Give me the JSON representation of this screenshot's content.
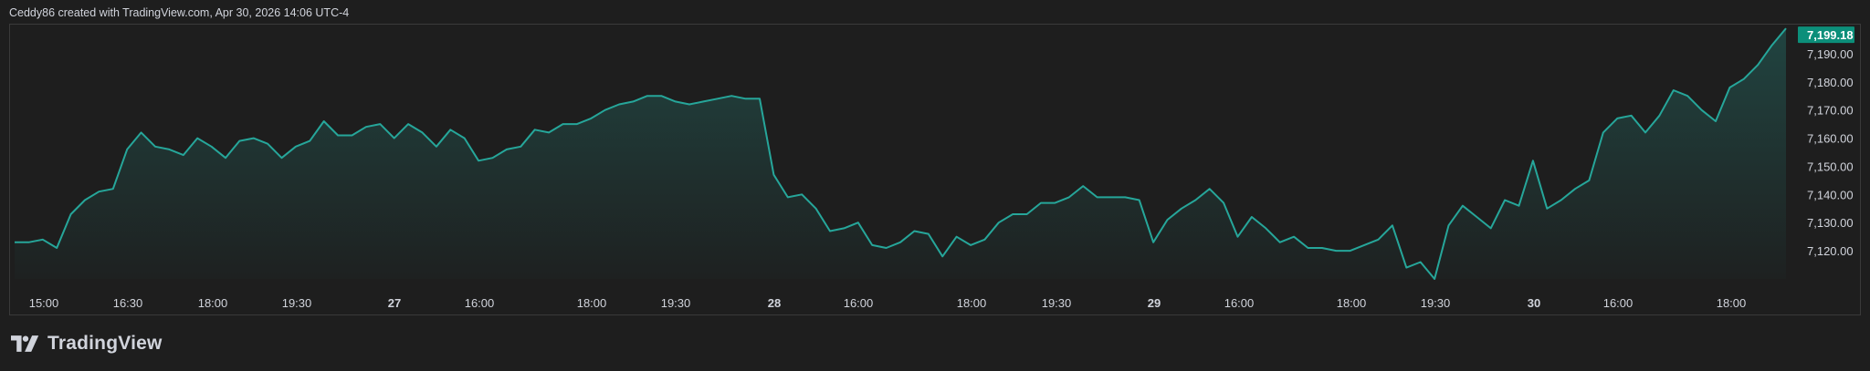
{
  "header": {
    "created_text": "Ceddy86 created with TradingView.com, Apr 30, 2026 14:06 UTC-4"
  },
  "brand": {
    "name": "TradingView",
    "icon": "tradingview-logo-icon"
  },
  "colors": {
    "line": "#26a69a",
    "badge": "#0c8f7a",
    "background": "#1e1e1e",
    "axis_text": "#d1d4dc"
  },
  "chart_data": {
    "type": "area",
    "last_price": "7,199.18",
    "ylim": [
      7110,
      7200
    ],
    "y_ticks": [
      {
        "value": 7120,
        "label": "7,120.00"
      },
      {
        "value": 7130,
        "label": "7,130.00"
      },
      {
        "value": 7140,
        "label": "7,140.00"
      },
      {
        "value": 7150,
        "label": "7,150.00"
      },
      {
        "value": 7160,
        "label": "7,160.00"
      },
      {
        "value": 7170,
        "label": "7,170.00"
      },
      {
        "value": 7180,
        "label": "7,180.00"
      },
      {
        "value": 7190,
        "label": "7,190.00"
      }
    ],
    "x_ticks": [
      {
        "label": "15:00",
        "bold": false
      },
      {
        "label": "16:30",
        "bold": false
      },
      {
        "label": "18:00",
        "bold": false
      },
      {
        "label": "19:30",
        "bold": false
      },
      {
        "label": "27",
        "bold": true
      },
      {
        "label": "16:00",
        "bold": false
      },
      {
        "label": "18:00",
        "bold": false
      },
      {
        "label": "19:30",
        "bold": false
      },
      {
        "label": "28",
        "bold": true
      },
      {
        "label": "16:00",
        "bold": false
      },
      {
        "label": "18:00",
        "bold": false
      },
      {
        "label": "19:30",
        "bold": false
      },
      {
        "label": "29",
        "bold": true
      },
      {
        "label": "16:00",
        "bold": false
      },
      {
        "label": "18:00",
        "bold": false
      },
      {
        "label": "19:30",
        "bold": false
      },
      {
        "label": "30",
        "bold": true
      },
      {
        "label": "16:00",
        "bold": false
      },
      {
        "label": "18:00",
        "bold": false
      }
    ],
    "values": [
      7123,
      7123,
      7124,
      7121,
      7133,
      7138,
      7141,
      7142,
      7156,
      7162,
      7157,
      7156,
      7154,
      7160,
      7157,
      7153,
      7159,
      7160,
      7158,
      7153,
      7157,
      7159,
      7166,
      7161,
      7161,
      7164,
      7165,
      7160,
      7165,
      7162,
      7157,
      7163,
      7160,
      7152,
      7153,
      7156,
      7157,
      7163,
      7162,
      7165,
      7165,
      7167,
      7170,
      7172,
      7173,
      7175,
      7175,
      7173,
      7172,
      7173,
      7174,
      7175,
      7174,
      7174,
      7147,
      7139,
      7140,
      7135,
      7127,
      7128,
      7130,
      7122,
      7121,
      7123,
      7127,
      7126,
      7118,
      7125,
      7122,
      7124,
      7130,
      7133,
      7133,
      7137,
      7137,
      7139,
      7143,
      7139,
      7139,
      7139,
      7138,
      7123,
      7131,
      7135,
      7138,
      7142,
      7137,
      7125,
      7132,
      7128,
      7123,
      7125,
      7121,
      7121,
      7120,
      7120,
      7122,
      7124,
      7129,
      7114,
      7116,
      7110,
      7129,
      7136,
      7132,
      7128,
      7138,
      7136,
      7152,
      7135,
      7138,
      7142,
      7145,
      7162,
      7167,
      7168,
      7162,
      7168,
      7177,
      7175,
      7170,
      7166,
      7178,
      7181,
      7186,
      7193,
      7199
    ]
  }
}
